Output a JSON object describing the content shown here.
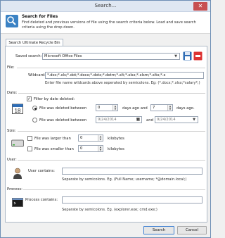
{
  "window": {
    "title": "Search..."
  },
  "header": {
    "title": "Search for Files",
    "description": "Find deleted and previous versions of file using the search criteria below. Load and save search criteria using the drop down."
  },
  "tab": {
    "label": "Search Ultimate Recycle Bin"
  },
  "saved_search": {
    "label": "Saved search:",
    "value": "Microsoft Office Files"
  },
  "file": {
    "section": "File:",
    "wildcard_label": "Wildcard:",
    "wildcard_value": "*.doc;*.xls;*.dot;*.docx;*.dotx;*.dotm;*.xlt;*.xlsx;*.xlsm;*.xltx;*.x",
    "hint": "Enter file name wildcards above seperated by semicolons. Eg: (*.docx;*.xlsx;*salary*;)"
  },
  "date": {
    "section": "Date:",
    "filter_label": "Filter by date deleted:",
    "filter_checked": true,
    "between_days_label": "File was deleted between",
    "days_from": "0",
    "days_and_label": "days ago and",
    "days_to": "7",
    "days_ago_label": "days ago.",
    "between_dates_label": "File was deleted between",
    "date_from": "9/24/2014",
    "dates_and_label": "and",
    "date_to": "9/24/2014"
  },
  "size": {
    "section": "Size:",
    "larger_label": "File was larger than",
    "larger_value": "0",
    "larger_unit": "kilobytes",
    "smaller_label": "File was smaller than",
    "smaller_value": "0",
    "smaller_unit": "kilobytes"
  },
  "user": {
    "section": "User:",
    "contains_label": "User contains:",
    "value": "",
    "hint": "Separate by semicolons. Eg. (Full Name; username; *@domain.local;)"
  },
  "process": {
    "section": "Process:",
    "contains_label": "Process contains:",
    "value": "",
    "hint": "Separate by semicolons. Eg. (explorer.exe; cmd.exe;)"
  },
  "buttons": {
    "search": "Search",
    "cancel": "Cancel"
  },
  "icons": {
    "search": "search-magnifier-icon",
    "save": "save-disk-icon",
    "delete": "delete-icon",
    "calendar": "calendar-icon",
    "drive": "hard-drive-icon",
    "user": "user-icon",
    "process": "console-window-icon"
  },
  "colors": {
    "accent": "#3c7fd1",
    "close": "#c75050",
    "panel_border": "#aeb9c7"
  }
}
